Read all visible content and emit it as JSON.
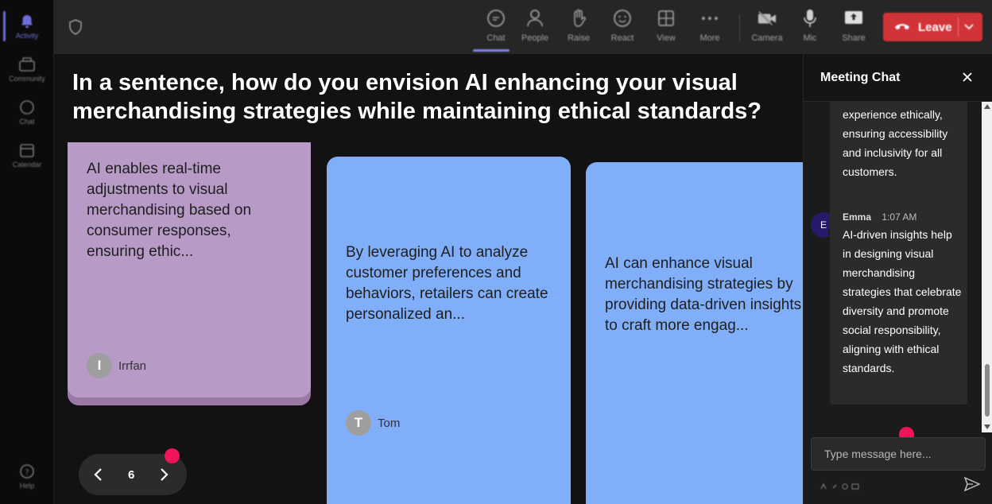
{
  "rail": {
    "items": [
      {
        "label": "Activity",
        "icon": "bell-icon",
        "active": true
      },
      {
        "label": "Community",
        "icon": "community-icon"
      },
      {
        "label": "Chat",
        "icon": "chat-icon"
      },
      {
        "label": "Calendar",
        "icon": "calendar-icon"
      }
    ],
    "help_label": "Help"
  },
  "toolbar": {
    "chat": "Chat",
    "people": "People",
    "raise": "Raise",
    "react": "React",
    "view": "View",
    "more": "More",
    "camera": "Camera",
    "mic": "Mic",
    "share": "Share",
    "leave": "Leave"
  },
  "stage": {
    "question": "In a sentence, how do you envision AI enhancing your visual merchandising strategies while maintaining ethical standards?",
    "cards": [
      {
        "text": "AI enables real-time adjustments to visual merchandising based on consumer responses, ensuring ethic...",
        "author": "Irrfan",
        "initial": "I"
      },
      {
        "text": "By leveraging AI to analyze customer preferences and behaviors, retailers can create personalized an...",
        "author": "Tom",
        "initial": "T"
      },
      {
        "text": "AI can enhance visual merchandising strategies by providing data-driven insights to craft more engag..."
      }
    ],
    "page_number": "6"
  },
  "chat": {
    "title": "Meeting Chat",
    "messages": [
      {
        "text": "experience ethically, ensuring accessibility and inclusivity for all customers."
      },
      {
        "author": "Emma",
        "initial": "E",
        "time": "1:07 AM",
        "text": "AI-driven insights help in designing visual merchandising strategies that celebrate diversity and promote social responsibility, aligning with ethical standards."
      }
    ],
    "input_placeholder": "Type message here..."
  },
  "colors": {
    "accent": "#7f83e6",
    "leave": "#d13438",
    "card_purple": "#b89ac7",
    "card_blue": "#80aef8",
    "indicator": "#f0145a"
  }
}
